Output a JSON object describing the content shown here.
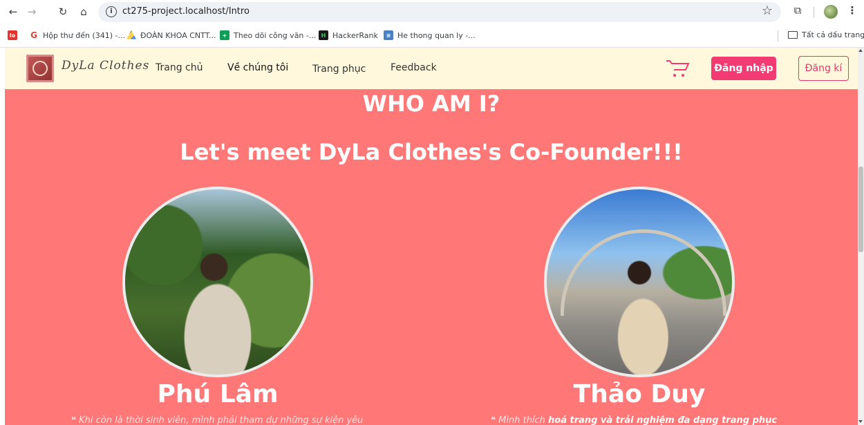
{
  "browser": {
    "url": "ct275-project.localhost/Intro",
    "icons": [
      "back-icon",
      "forward-icon",
      "reload-icon",
      "home-icon",
      "info-icon",
      "star-icon",
      "extensions-icon",
      "profile-avatar",
      "menu-icon"
    ]
  },
  "bookmarks": {
    "items": [
      {
        "label": "Hộp thư đến (341) -...",
        "icon": "gmail-icon",
        "color": "#db4437"
      },
      {
        "label": "ĐOÀN KHOA CNTT...",
        "icon": "drive-icon",
        "color": "#1fa463"
      },
      {
        "label": "Theo dõi công văn -...",
        "icon": "sheets-icon",
        "color": "#0f9d58"
      },
      {
        "label": "HackerRank",
        "icon": "hackerrank-icon",
        "color": "#1a1a1a"
      },
      {
        "label": "He thong quan ly -...",
        "icon": "site-icon",
        "color": "#4a7fc1"
      }
    ],
    "all_bookmarks": "Tất cả dấu trang"
  },
  "site_nav": {
    "logo_text": "DyLa Clothes",
    "links": [
      "Trang chủ",
      "Về chúng tôi",
      "Trang phục",
      "Feedback"
    ],
    "active_link": "Về chúng tôi",
    "login_label": "Đăng nhập",
    "register_label": "Đăng kí",
    "accent_color": "#f23b73"
  },
  "main": {
    "background": "#ff7877",
    "heading": "WHO AM I?",
    "subheading": "Let's meet DyLa Clothes's Co-Founder!!!",
    "founders": [
      {
        "name": "Phú Lâm",
        "quote": "Khi còn là thời sinh viên, mình phải tham dự những sự kiện yêu"
      },
      {
        "name": "Thảo Duy",
        "quote_prefix": "Mình thích ",
        "quote_bold": "hoá trang và trải nghiệm đa dạng trang phục"
      }
    ]
  }
}
